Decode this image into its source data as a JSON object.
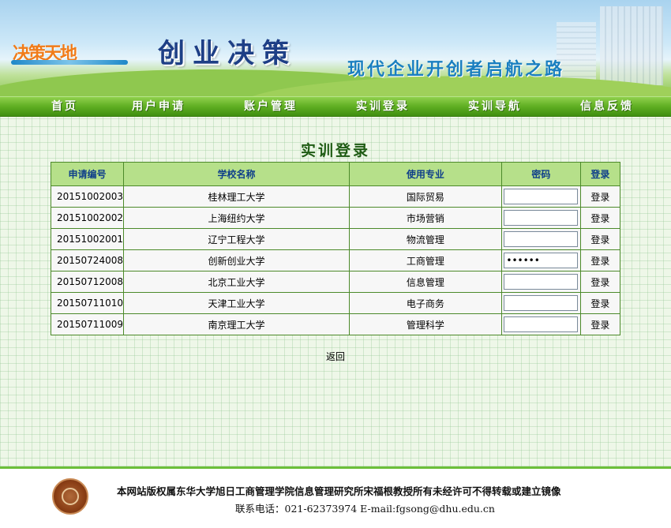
{
  "header": {
    "logo_text": "决策天地",
    "title": "创业决策",
    "slogan": "现代企业开创者启航之路"
  },
  "nav": {
    "items": [
      {
        "label": "首页"
      },
      {
        "label": "用户申请"
      },
      {
        "label": "账户管理"
      },
      {
        "label": "实训登录"
      },
      {
        "label": "实训导航"
      },
      {
        "label": "信息反馈"
      }
    ]
  },
  "main": {
    "heading": "实训登录",
    "table": {
      "headers": [
        "申请编号",
        "学校名称",
        "使用专业",
        "密码",
        "登录"
      ],
      "rows": [
        {
          "id": "20151002003",
          "school": "桂林理工大学",
          "major": "国际贸易",
          "password": "",
          "action": "登录"
        },
        {
          "id": "20151002002",
          "school": "上海纽约大学",
          "major": "市场营销",
          "password": "",
          "action": "登录"
        },
        {
          "id": "20151002001",
          "school": "辽宁工程大学",
          "major": "物流管理",
          "password": "",
          "action": "登录"
        },
        {
          "id": "20150724008",
          "school": "创新创业大学",
          "major": "工商管理",
          "password": "••••••",
          "action": "登录"
        },
        {
          "id": "20150712008",
          "school": "北京工业大学",
          "major": "信息管理",
          "password": "",
          "action": "登录"
        },
        {
          "id": "20150711010",
          "school": "天津工业大学",
          "major": "电子商务",
          "password": "",
          "action": "登录"
        },
        {
          "id": "20150711009",
          "school": "南京理工大学",
          "major": "管理科学",
          "password": "",
          "action": "登录"
        }
      ]
    },
    "back_label": "返回"
  },
  "footer": {
    "copyright": "本网站版权属东华大学旭日工商管理学院信息管理研究所宋福根教授所有未经许可不得转载或建立镜像",
    "contact": "联系电话：021-62373974  E-mail:fgsong@dhu.edu.cn"
  }
}
